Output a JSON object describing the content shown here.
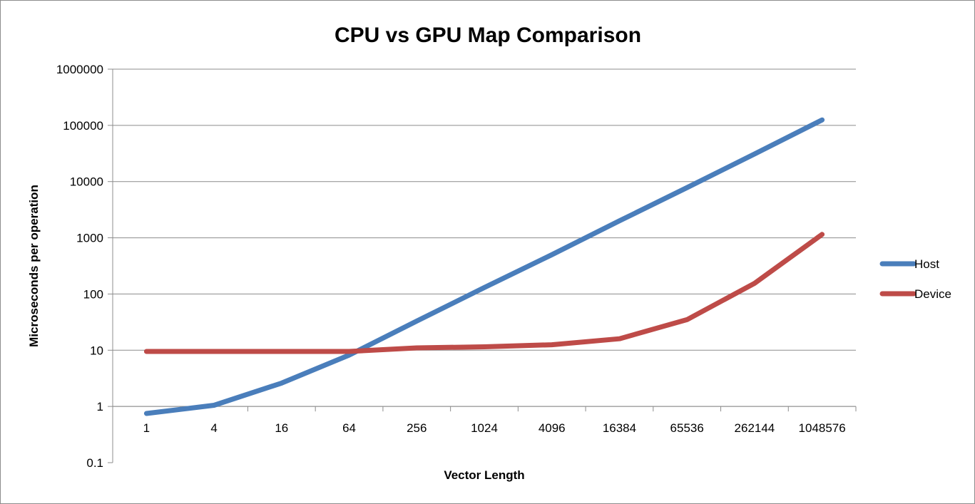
{
  "chart_data": {
    "type": "line",
    "title": "CPU vs GPU Map Comparison",
    "xlabel": "Vector Length",
    "ylabel": "Microseconds per operation",
    "y_scale": "log",
    "ylim": [
      0.1,
      1000000
    ],
    "y_ticks": [
      "1000000",
      "100000",
      "10000",
      "1000",
      "100",
      "10",
      "1",
      "0.1"
    ],
    "categories": [
      "1",
      "4",
      "16",
      "64",
      "256",
      "1024",
      "4096",
      "16384",
      "65536",
      "262144",
      "1048576"
    ],
    "series": [
      {
        "name": "Host",
        "color": "#4a7ebb",
        "values": [
          0.75,
          1.05,
          2.6,
          8.2,
          33,
          130,
          500,
          2000,
          7800,
          31000,
          125000
        ]
      },
      {
        "name": "Device",
        "color": "#be4b48",
        "values": [
          9.5,
          9.5,
          9.5,
          9.5,
          11,
          11.5,
          12.5,
          16,
          35,
          155,
          1150
        ]
      }
    ],
    "grid": "horizontal",
    "legend_position": "right"
  }
}
